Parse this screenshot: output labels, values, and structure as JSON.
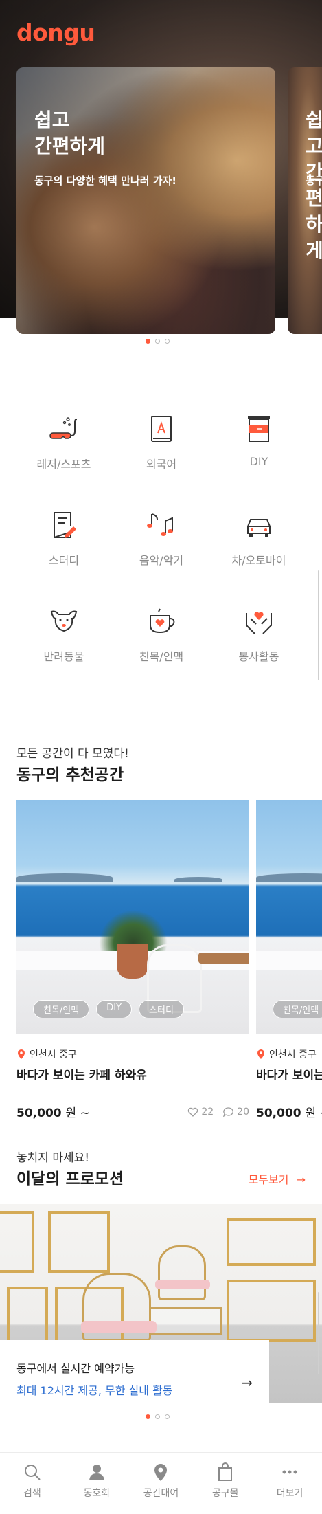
{
  "app": {
    "logo": "dongu",
    "accent_color": "#ff5a3c",
    "link_color": "#2f6fd1"
  },
  "hero": {
    "cards": [
      {
        "title": "쉽고\n간편하게",
        "subtitle": "동구의 다양한 혜택 만나러 가자!"
      },
      {
        "title": "쉽고\n간편하게",
        "subtitle": "동구의 다양한 혜택 만나러 가자!"
      }
    ],
    "pagination": {
      "total": 3,
      "active": 1
    }
  },
  "categories": [
    {
      "label": "레저/스포츠",
      "icon": "snorkel-icon"
    },
    {
      "label": "외국어",
      "icon": "book-icon"
    },
    {
      "label": "DIY",
      "icon": "paint-can-icon"
    },
    {
      "label": "스터디",
      "icon": "notepad-pencil-icon"
    },
    {
      "label": "음악/악기",
      "icon": "music-notes-icon"
    },
    {
      "label": "차/오토바이",
      "icon": "car-icon"
    },
    {
      "label": "반려동물",
      "icon": "dog-icon"
    },
    {
      "label": "친목/인맥",
      "icon": "cup-heart-icon"
    },
    {
      "label": "봉사활동",
      "icon": "hands-heart-icon"
    }
  ],
  "recommend": {
    "subtitle": "모든 공간이 다 모였다!",
    "title": "동구의 추천공간",
    "items": [
      {
        "tags": [
          "친목/인맥",
          "DIY",
          "스터디"
        ],
        "location": "인천시 중구",
        "name": "바다가 보이는 카페 하와유",
        "price": "50,000",
        "price_unit": "원 ~",
        "likes": "22",
        "comments": "20"
      },
      {
        "tags": [
          "친목/인맥"
        ],
        "location": "인천시 중구",
        "name": "바다가 보이는",
        "price": "50,000",
        "price_unit": "원 ~"
      }
    ]
  },
  "promotion": {
    "subtitle": "놓치지 마세요!",
    "title": "이달의 프로모션",
    "see_all": "모두보기",
    "line1": "동구에서 실시간 예약가능",
    "line2": "최대 12시간 제공, 무한 실내 활동",
    "arrow": "→",
    "pagination": {
      "total": 3,
      "active": 1
    }
  },
  "bottom_nav": [
    {
      "label": "검색",
      "icon": "search-icon"
    },
    {
      "label": "동호회",
      "icon": "person-icon"
    },
    {
      "label": "공간대여",
      "icon": "location-pin-icon"
    },
    {
      "label": "공구몰",
      "icon": "shopping-bag-icon"
    },
    {
      "label": "더보기",
      "icon": "more-dots-icon"
    }
  ]
}
